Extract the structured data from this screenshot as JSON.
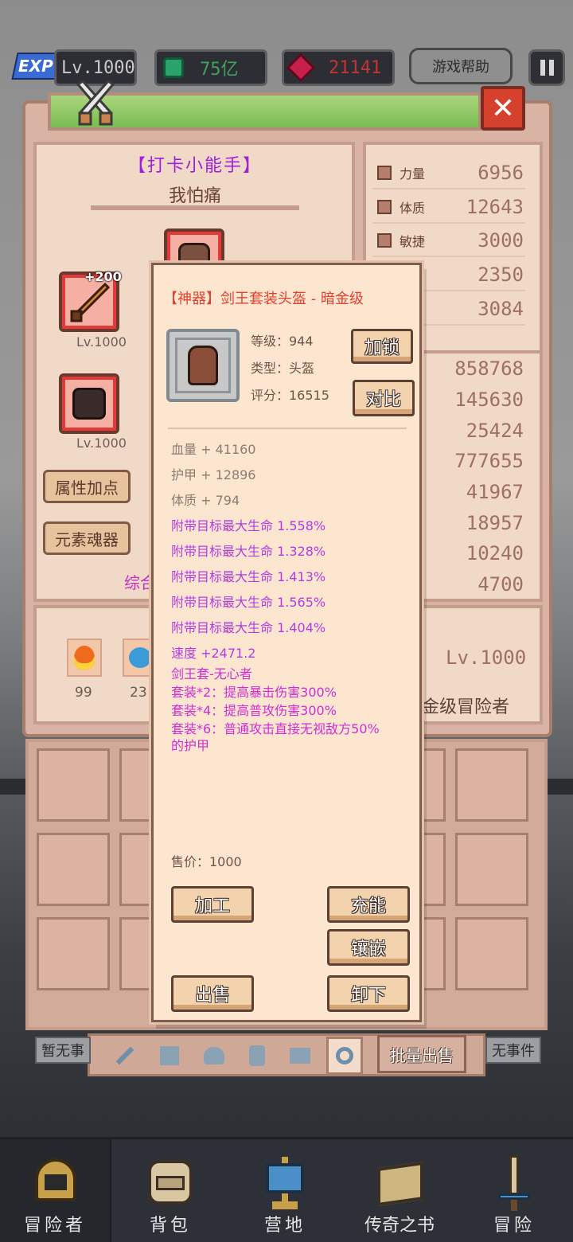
{
  "topbar": {
    "exp_badge": "EXP",
    "level": "Lv.1000",
    "currency_green": "75亿",
    "currency_red": "21141",
    "help_label": "游戏帮助"
  },
  "hero": {
    "title": "【打卡小能手】",
    "name": "我怕痛",
    "weapon_bonus": "+200",
    "weapon_level": "Lv.1000",
    "glove_level": "Lv.1000",
    "btn_attr": "属性加点",
    "btn_element": "元素魂器",
    "partial_combined": "综合"
  },
  "stats_top": [
    {
      "label": "力量",
      "value": "6956"
    },
    {
      "label": "体质",
      "value": "12643"
    },
    {
      "label": "敏捷",
      "value": "3000"
    },
    {
      "value": "2350"
    },
    {
      "value": "3084"
    }
  ],
  "stats_bottom": [
    "858768",
    "145630",
    "25424",
    "777655",
    "41967",
    "18957",
    "10240",
    "4700"
  ],
  "items_row": {
    "fire_count": "99",
    "blue_count": "23",
    "level_badge": "Lv.1000",
    "rank_text": "金级冒险者"
  },
  "background": {
    "left_tag": "暂无事",
    "right_tag": "无事件",
    "batch_sell": "批量出售"
  },
  "popup": {
    "title": "【神器】剑王套装头盔 - 暗金级",
    "level": "等级：944",
    "type": "类型：头盔",
    "score": "评分：16515",
    "btn_lock": "加锁",
    "btn_compare": "对比",
    "base_stats": [
      "血量 + 41160",
      "护甲 + 12896",
      "体质 + 794"
    ],
    "affixes": [
      "附带目标最大生命 1.558%",
      "附带目标最大生命 1.328%",
      "附带目标最大生命 1.413%",
      "附带目标最大生命 1.565%",
      "附带目标最大生命 1.404%",
      "速度 +2471.2"
    ],
    "set_name": "剑王套-无心者",
    "set_bonuses": [
      "套装*2：提高暴击伤害300%",
      "套装*4：提高普攻伤害300%",
      "套装*6：普通攻击直接无视敌方50%",
      "的护甲"
    ],
    "price": "售价：1000",
    "btn_process": "加工",
    "btn_charge": "充能",
    "btn_inlay": "镶嵌",
    "btn_sell": "出售",
    "btn_unequip": "卸下"
  },
  "nav": [
    {
      "label": "冒险者"
    },
    {
      "label": "背包"
    },
    {
      "label": "营地"
    },
    {
      "label": "传奇之书"
    },
    {
      "label": "冒险"
    }
  ]
}
